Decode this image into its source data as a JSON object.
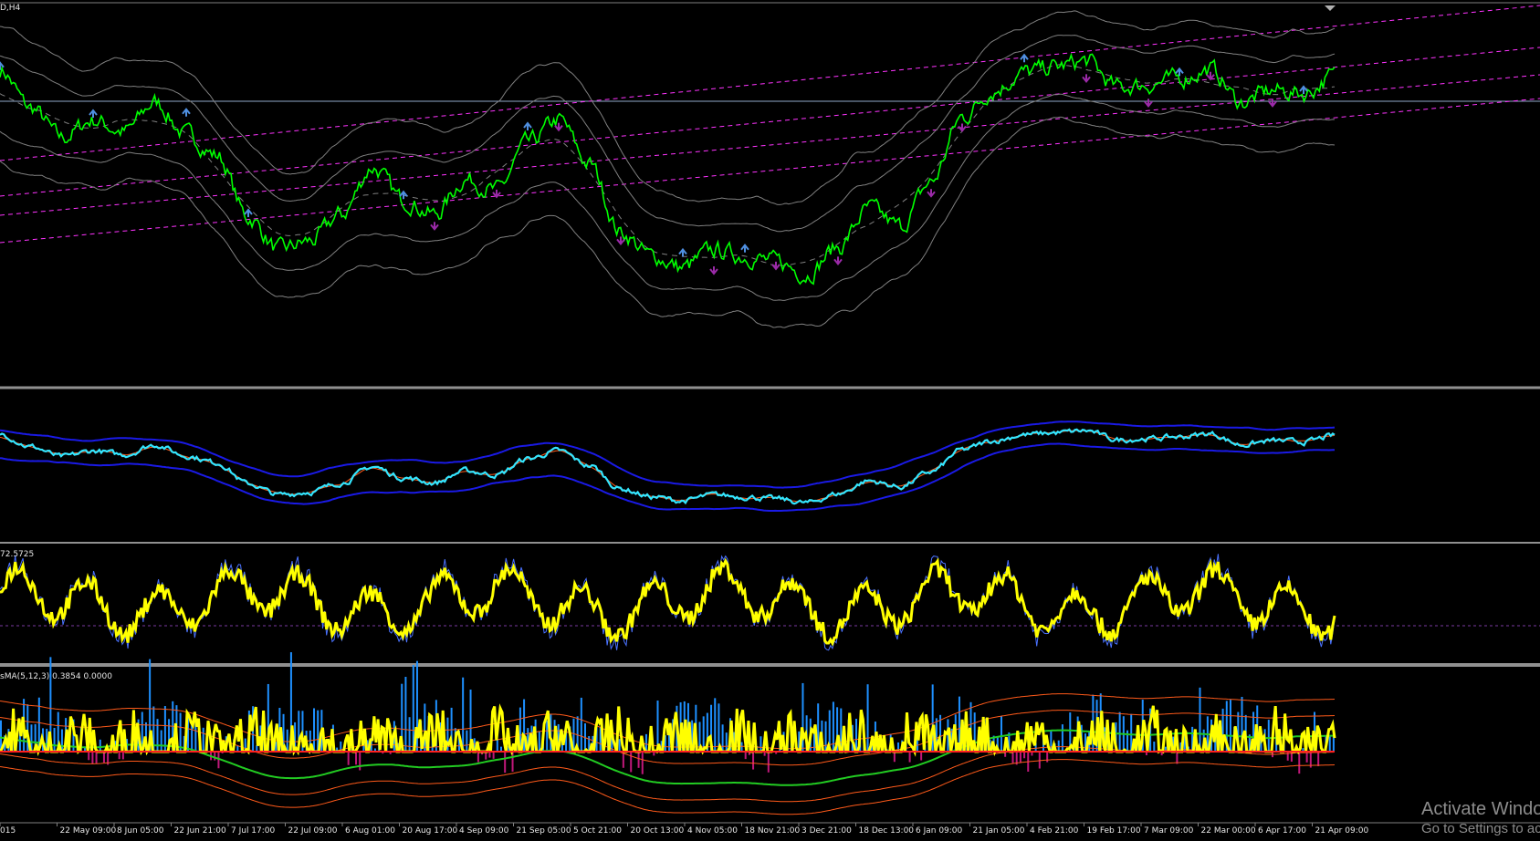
{
  "pane_labels": {
    "main": "D,H4",
    "pane3": "72.5725",
    "pane4": "sMA(5,12,3) 0.3854 0.0000"
  },
  "watermark": {
    "line1": "Activate Windo",
    "line2": "Go to Settings to ac"
  },
  "colors": {
    "background": "#000000",
    "price": "#00ff00",
    "envelope": "#808080",
    "channel": "#ff33ff",
    "hline": "#8fa8c8",
    "arrow_up": "#4f8fe0",
    "arrow_down": "#9b2aa8",
    "pane2_band": "#1a1ae6",
    "pane2_price": "#33e6ff",
    "pane3_line": "#ffff00",
    "pane3_thin": "#4a72ff",
    "pane4_pos": "#1e90ff",
    "pane4_neg": "#c0187a",
    "pane4_line": "#ffff00",
    "pane4_orange": "#ff5a1a",
    "pane4_green": "#22cc22",
    "axis_text": "#e6e6e6"
  },
  "chart_data": {
    "type": "line",
    "x_tick_labels": [
      "015",
      "22 May 09:00",
      "8 Jun 05:00",
      "22 Jun 21:00",
      "7 Jul 17:00",
      "22 Jul 09:00",
      "6 Aug 01:00",
      "20 Aug 17:00",
      "4 Sep 09:00",
      "21 Sep 05:00",
      "5 Oct 21:00",
      "20 Oct 13:00",
      "4 Nov 05:00",
      "18 Nov 21:00",
      "3 Dec 21:00",
      "18 Dec 13:00",
      "6 Jan 09:00",
      "21 Jan 05:00",
      "4 Feb 21:00",
      "19 Feb 17:00",
      "7 Mar 09:00",
      "22 Mar 00:00",
      "6 Apr 17:00",
      "21 Apr 09:00"
    ],
    "price_profile": [
      0.85,
      0.72,
      0.62,
      0.68,
      0.64,
      0.74,
      0.63,
      0.56,
      0.35,
      0.24,
      0.27,
      0.36,
      0.52,
      0.41,
      0.36,
      0.48,
      0.44,
      0.6,
      0.68,
      0.53,
      0.3,
      0.22,
      0.18,
      0.24,
      0.22,
      0.2,
      0.16,
      0.25,
      0.38,
      0.32,
      0.47,
      0.69,
      0.78,
      0.84,
      0.86,
      0.88,
      0.79,
      0.8,
      0.82,
      0.85,
      0.74,
      0.78,
      0.77,
      0.83
    ],
    "up_arrow_indices": [
      0,
      3,
      6,
      8,
      13,
      17,
      22,
      24,
      33,
      38,
      42
    ],
    "down_arrow_indices": [
      14,
      16,
      18,
      20,
      23,
      25,
      27,
      30,
      31,
      35,
      37,
      39,
      41
    ]
  }
}
